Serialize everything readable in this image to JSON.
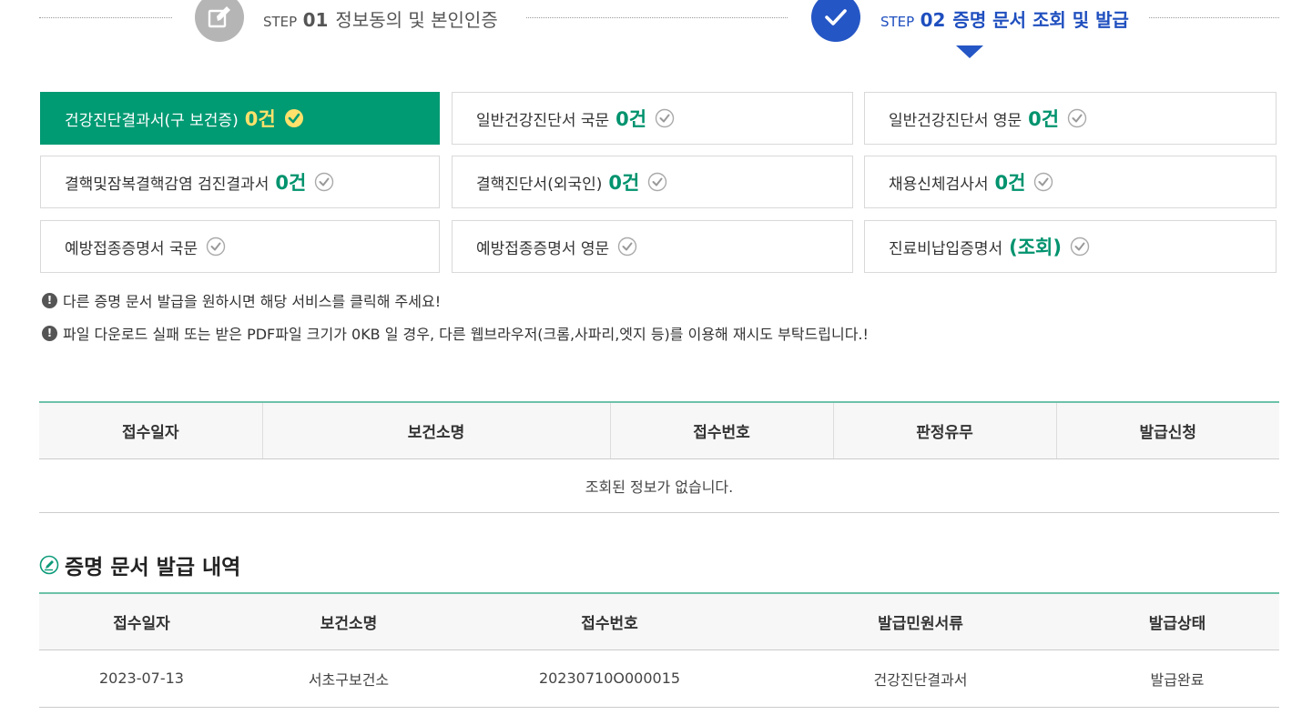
{
  "steps": {
    "step1": {
      "prefix": "STEP",
      "num": "01",
      "label": "정보동의 및 본인인증"
    },
    "step2": {
      "prefix": "STEP",
      "num": "02",
      "label": "증명 문서 조회 및 발급"
    }
  },
  "documents": [
    {
      "name": "건강진단결과서(구 보건증)",
      "count": "0건"
    },
    {
      "name": "일반건강진단서 국문",
      "count": "0건"
    },
    {
      "name": "일반건강진단서 영문",
      "count": "0건"
    },
    {
      "name": "결핵및잠복결핵감염 검진결과서",
      "count": "0건"
    },
    {
      "name": "결핵진단서(외국인)",
      "count": "0건"
    },
    {
      "name": "채용신체검사서",
      "count": "0건"
    },
    {
      "name": "예방접종증명서 국문",
      "count": ""
    },
    {
      "name": "예방접종증명서 영문",
      "count": ""
    },
    {
      "name": "진료비납입증명서",
      "count": "(조회)"
    }
  ],
  "notices": {
    "n1": "다른 증명 문서 발급을 원하시면 해당 서비스를 클릭해 주세요!",
    "n2": "파일 다운로드 실패 또는 받은 PDF파일 크기가 0KB 일 경우, 다른 웹브라우저(크롬,사파리,엣지 등)를 이용해 재시도 부탁드립니다.!"
  },
  "receipt_table": {
    "headers": [
      "접수일자",
      "보건소명",
      "접수번호",
      "판정유무",
      "발급신청"
    ],
    "empty_message": "조회된 정보가 없습니다."
  },
  "history": {
    "title": "증명 문서 발급 내역",
    "headers": [
      "접수일자",
      "보건소명",
      "접수번호",
      "발급민원서류",
      "발급상태"
    ],
    "rows": [
      [
        "2023-07-13",
        "서초구보건소",
        "20230710O000015",
        "건강진단결과서",
        "발급완료"
      ]
    ]
  },
  "colors": {
    "accent_green": "#009a73",
    "step_blue": "#2556c5",
    "count_yellow": "#ffe16b"
  },
  "icons": {
    "step1": "edit-icon",
    "step2": "check-icon",
    "doc_check": "check-circle-icon",
    "notice": "exclamation-icon",
    "section": "pencil-circle-icon"
  }
}
